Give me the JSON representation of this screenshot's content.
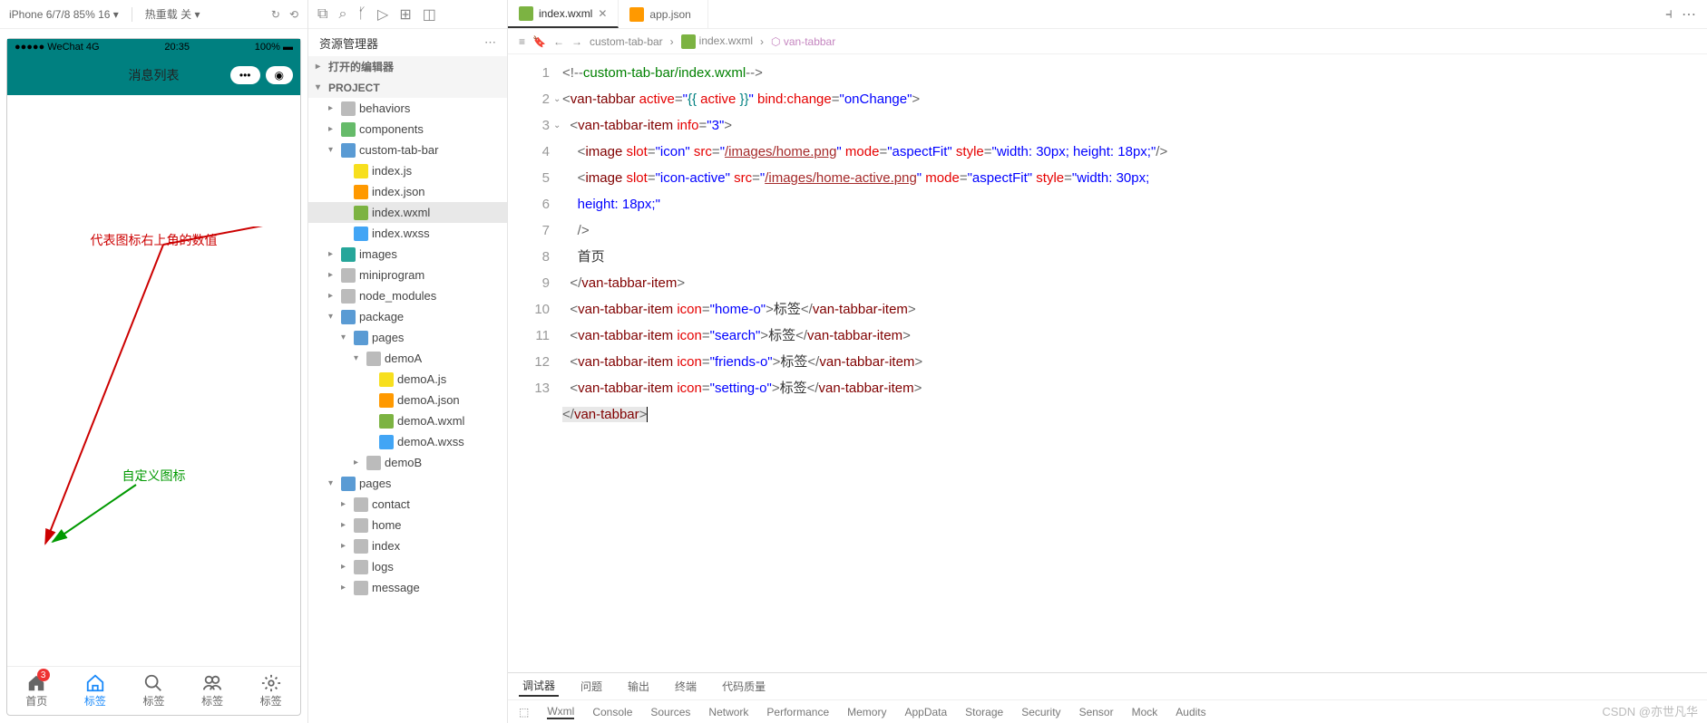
{
  "toolbar": {
    "device": "iPhone 6/7/8 85% 16 ▾",
    "hotreload": "热重载 关 ▾"
  },
  "simulator": {
    "status_left": "●●●●● WeChat 4G",
    "status_time": "20:35",
    "status_right": "100% ▬",
    "header_title": "消息列表",
    "annotation_red": "代表图标右上角的数值",
    "annotation_green": "自定义图标",
    "tabs": [
      {
        "label": "首页",
        "badge": "3"
      },
      {
        "label": "标签"
      },
      {
        "label": "标签"
      },
      {
        "label": "标签"
      },
      {
        "label": "标签"
      }
    ]
  },
  "explorer": {
    "title": "资源管理器",
    "section1": "打开的编辑器",
    "section2": "PROJECT",
    "items": [
      {
        "indent": 1,
        "chev": "▸",
        "ico": "ic-folder",
        "label": "behaviors"
      },
      {
        "indent": 1,
        "chev": "▸",
        "ico": "ic-ns",
        "label": "components"
      },
      {
        "indent": 1,
        "chev": "▾",
        "ico": "ic-folder-o",
        "label": "custom-tab-bar"
      },
      {
        "indent": 2,
        "chev": "",
        "ico": "ic-js",
        "label": "index.js"
      },
      {
        "indent": 2,
        "chev": "",
        "ico": "ic-json",
        "label": "index.json"
      },
      {
        "indent": 2,
        "chev": "",
        "ico": "ic-wxml",
        "label": "index.wxml",
        "selected": true
      },
      {
        "indent": 2,
        "chev": "",
        "ico": "ic-wxss",
        "label": "index.wxss"
      },
      {
        "indent": 1,
        "chev": "▸",
        "ico": "ic-img",
        "label": "images"
      },
      {
        "indent": 1,
        "chev": "▸",
        "ico": "ic-folder",
        "label": "miniprogram"
      },
      {
        "indent": 1,
        "chev": "▸",
        "ico": "ic-folder",
        "label": "node_modules"
      },
      {
        "indent": 1,
        "chev": "▾",
        "ico": "ic-folder-o",
        "label": "package"
      },
      {
        "indent": 2,
        "chev": "▾",
        "ico": "ic-folder-o",
        "label": "pages"
      },
      {
        "indent": 3,
        "chev": "▾",
        "ico": "ic-folder",
        "label": "demoA"
      },
      {
        "indent": 4,
        "chev": "",
        "ico": "ic-js",
        "label": "demoA.js"
      },
      {
        "indent": 4,
        "chev": "",
        "ico": "ic-json",
        "label": "demoA.json"
      },
      {
        "indent": 4,
        "chev": "",
        "ico": "ic-wxml",
        "label": "demoA.wxml"
      },
      {
        "indent": 4,
        "chev": "",
        "ico": "ic-wxss",
        "label": "demoA.wxss"
      },
      {
        "indent": 3,
        "chev": "▸",
        "ico": "ic-folder",
        "label": "demoB"
      },
      {
        "indent": 1,
        "chev": "▾",
        "ico": "ic-folder-o",
        "label": "pages"
      },
      {
        "indent": 2,
        "chev": "▸",
        "ico": "ic-folder",
        "label": "contact"
      },
      {
        "indent": 2,
        "chev": "▸",
        "ico": "ic-folder",
        "label": "home"
      },
      {
        "indent": 2,
        "chev": "▸",
        "ico": "ic-folder",
        "label": "index"
      },
      {
        "indent": 2,
        "chev": "▸",
        "ico": "ic-folder",
        "label": "logs"
      },
      {
        "indent": 2,
        "chev": "▸",
        "ico": "ic-folder",
        "label": "message"
      }
    ]
  },
  "tabs": [
    {
      "ico": "ic-wxml",
      "label": "index.wxml",
      "close": "✕",
      "active": true
    },
    {
      "ico": "ic-json",
      "label": "app.json",
      "close": " "
    }
  ],
  "breadcrumb": {
    "seg1": "custom-tab-bar",
    "seg2": "index.wxml",
    "seg3": "van-tabbar"
  },
  "code": {
    "lines": [
      "1",
      "2",
      "3",
      "4",
      "5",
      "6",
      "7",
      "8",
      "9",
      "10",
      "11",
      "12",
      "13"
    ]
  },
  "debugger": {
    "tabs": [
      "调试器",
      "问题",
      "输出",
      "终端",
      "代码质量"
    ],
    "sub": [
      "Wxml",
      "Console",
      "Sources",
      "Network",
      "Performance",
      "Memory",
      "AppData",
      "Storage",
      "Security",
      "Sensor",
      "Mock",
      "Audits"
    ]
  },
  "watermark": "CSDN @亦世凡华"
}
